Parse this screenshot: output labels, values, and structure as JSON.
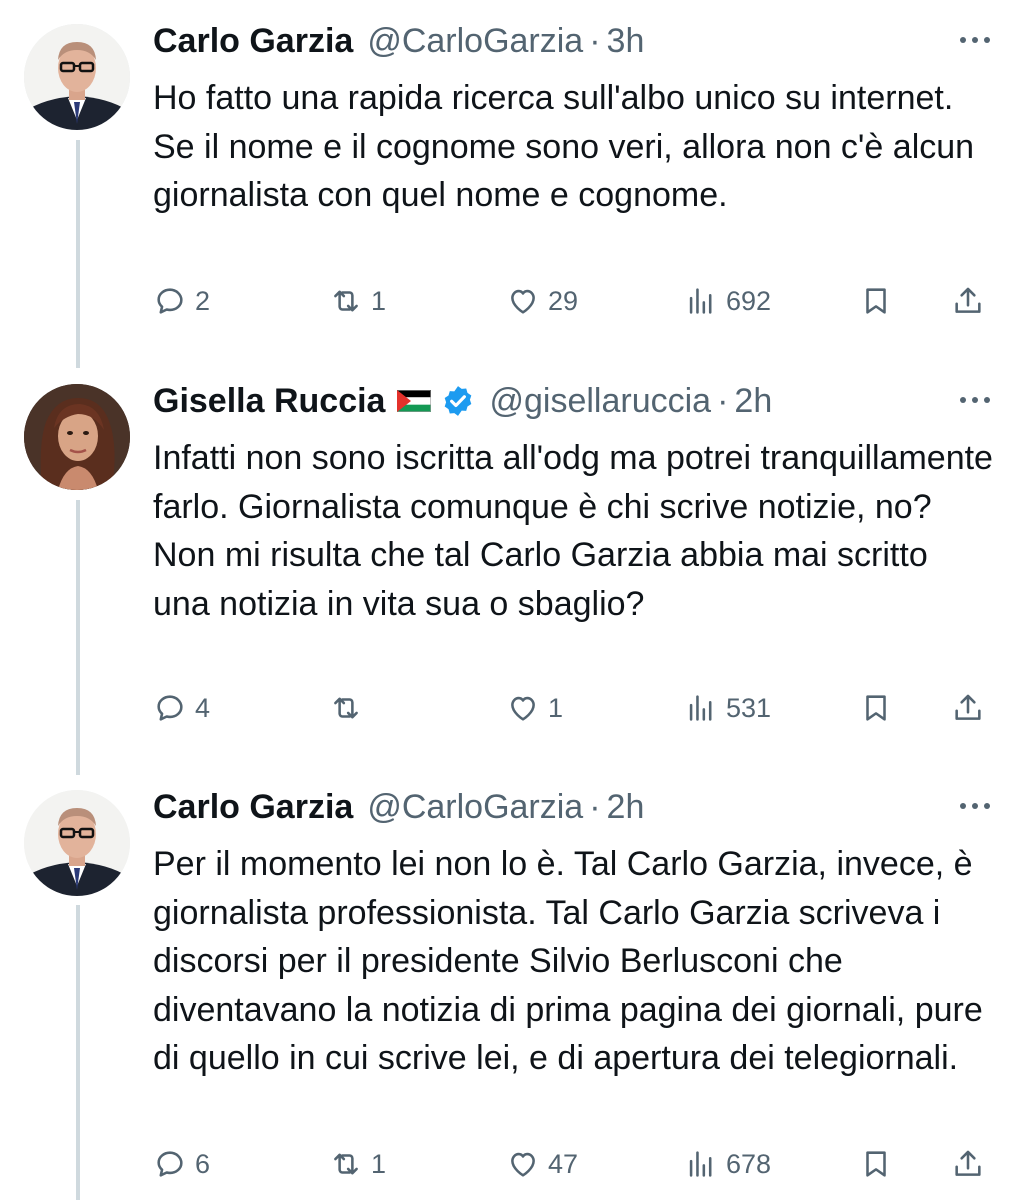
{
  "tweets": [
    {
      "author": "Carlo Garzia",
      "handle": "@CarloGarzia",
      "separator": "·",
      "time": "3h",
      "text": "Ho fatto una rapida ricerca sull'albo unico su internet. Se il nome e il cognome sono veri, allora non c'è alcun giornalista con quel nome e cognome.",
      "replies": "2",
      "reposts": "1",
      "likes": "29",
      "views": "692"
    },
    {
      "author": "Gisella Ruccia",
      "handle": "@gisellaruccia",
      "separator": "·",
      "time": "2h",
      "verified": true,
      "text": "Infatti non sono iscritta all'odg ma potrei tranquillamente farlo. Giornalista comunque è chi scrive notizie, no? Non mi risulta che tal Carlo Garzia abbia mai scritto una notizia in vita sua o sbaglio?",
      "replies": "4",
      "reposts": "",
      "likes": "1",
      "views": "531"
    },
    {
      "author": "Carlo Garzia",
      "handle": "@CarloGarzia",
      "separator": "·",
      "time": "2h",
      "text": "Per il momento lei non lo è. Tal Carlo Garzia, invece, è giornalista professionista. Tal Carlo Garzia scriveva i discorsi per il presidente Silvio Berlusconi che diventavano la notizia di prima pagina dei giornali, pure di quello in cui scrive lei, e di apertura dei telegiornali.",
      "replies": "6",
      "reposts": "1",
      "likes": "47",
      "views": "678"
    }
  ],
  "icons": {
    "reply": "reply-icon",
    "repost": "repost-icon",
    "like": "like-icon",
    "views": "views-icon",
    "bookmark": "bookmark-icon",
    "share": "share-icon",
    "more": "more-icon",
    "verified": "verified-badge-icon",
    "flag": "palestine-flag-icon"
  },
  "colors": {
    "text": "#0f1419",
    "secondary": "#536471",
    "thread_line": "#cfd9de",
    "verified": "#1d9bf0"
  }
}
